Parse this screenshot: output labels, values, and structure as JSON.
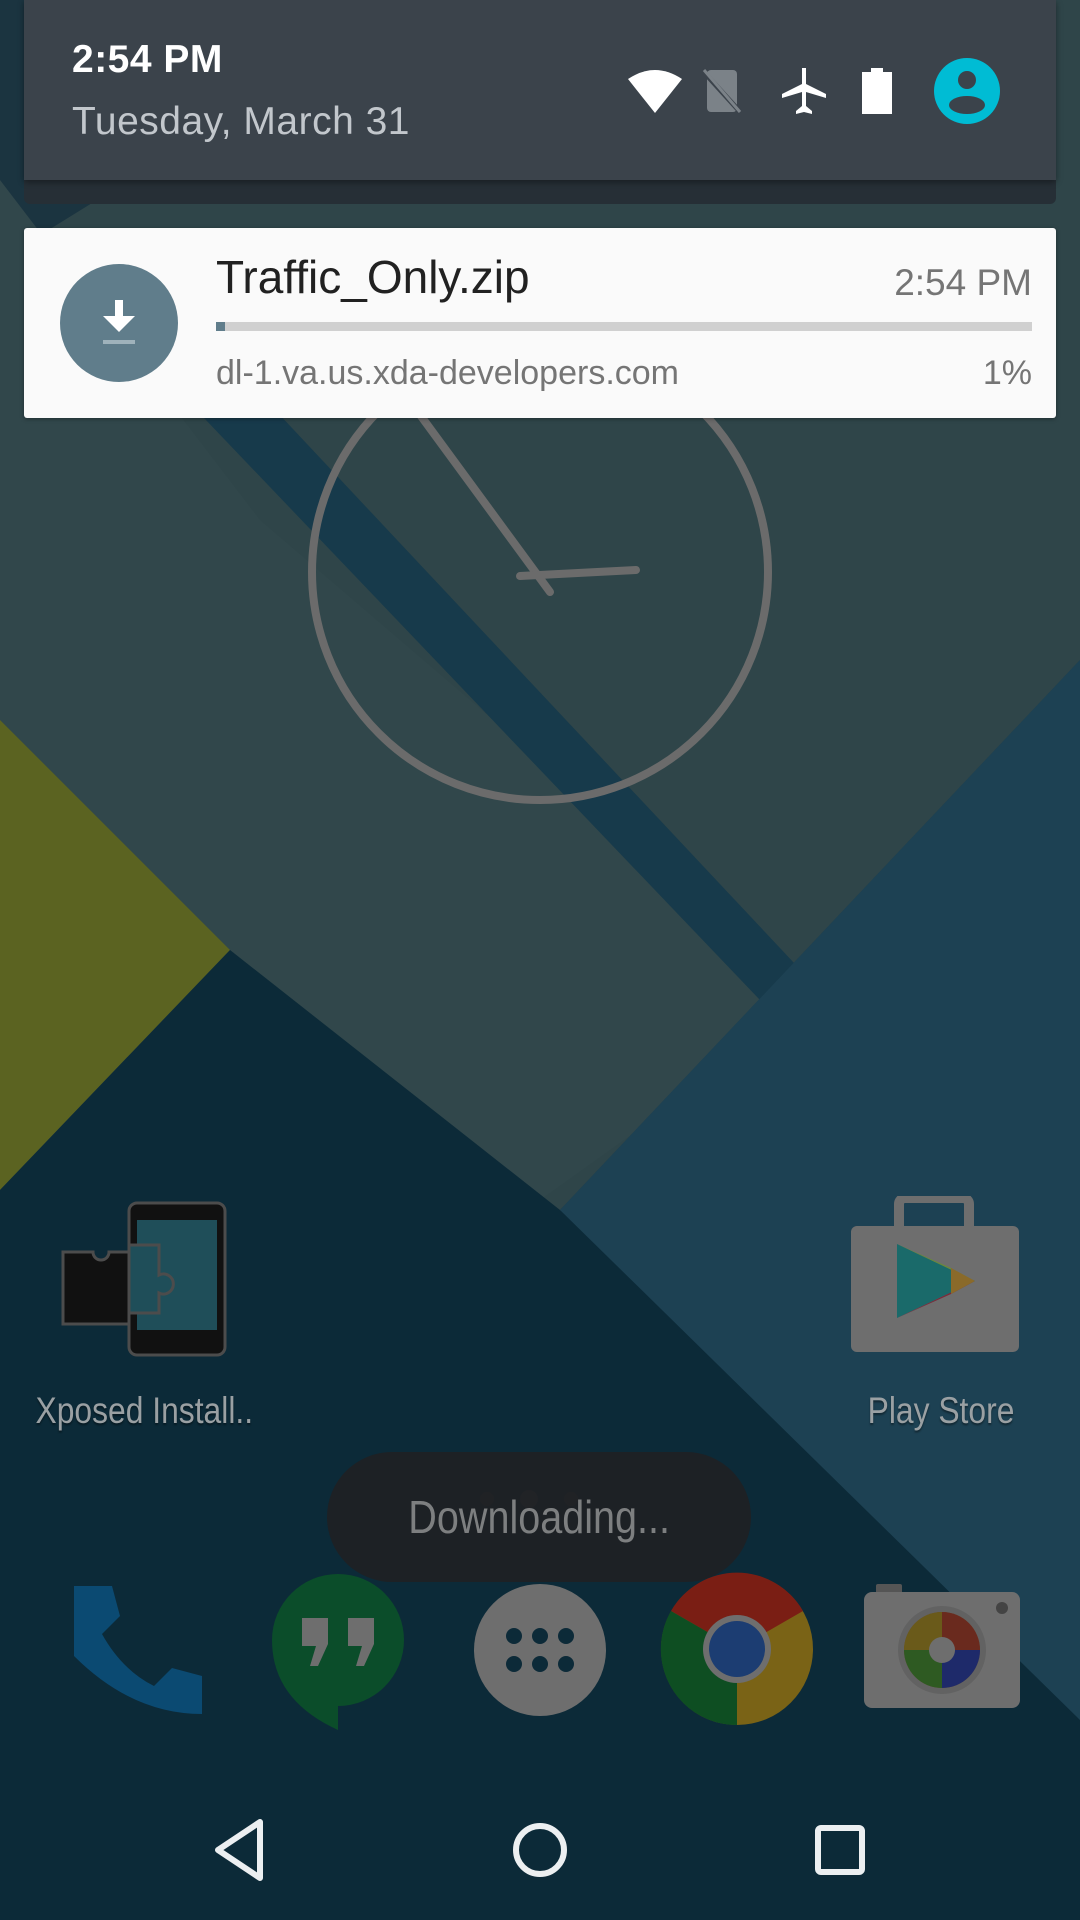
{
  "shade": {
    "time": "2:54 PM",
    "date": "Tuesday, March 31",
    "status_icons": [
      "wifi-icon",
      "no-sim-icon",
      "airplane-mode-icon",
      "battery-full-icon",
      "user-avatar-icon"
    ],
    "avatar_color": "#00bcd4"
  },
  "notification": {
    "title": "Traffic_Only.zip",
    "time": "2:54 PM",
    "source": "dl-1.va.us.xda-developers.com",
    "percent_label": "1%",
    "progress": 0.01,
    "icon": "download-icon",
    "icon_bg": "#607d8b"
  },
  "home": {
    "apps": [
      {
        "name": "xposed-installer",
        "label": "Xposed Install.."
      },
      {
        "name": "play-store",
        "label": "Play Store"
      }
    ],
    "dock": [
      "phone",
      "hangouts",
      "app-drawer",
      "chrome",
      "camera"
    ]
  },
  "toast": {
    "text": "Downloading..."
  },
  "page_indicator": {
    "count": 3,
    "active": 1
  },
  "navbar": {
    "buttons": [
      "back",
      "home",
      "recents"
    ]
  },
  "clock_widget": {
    "hour_hand": "2",
    "minute_hand": "54"
  }
}
